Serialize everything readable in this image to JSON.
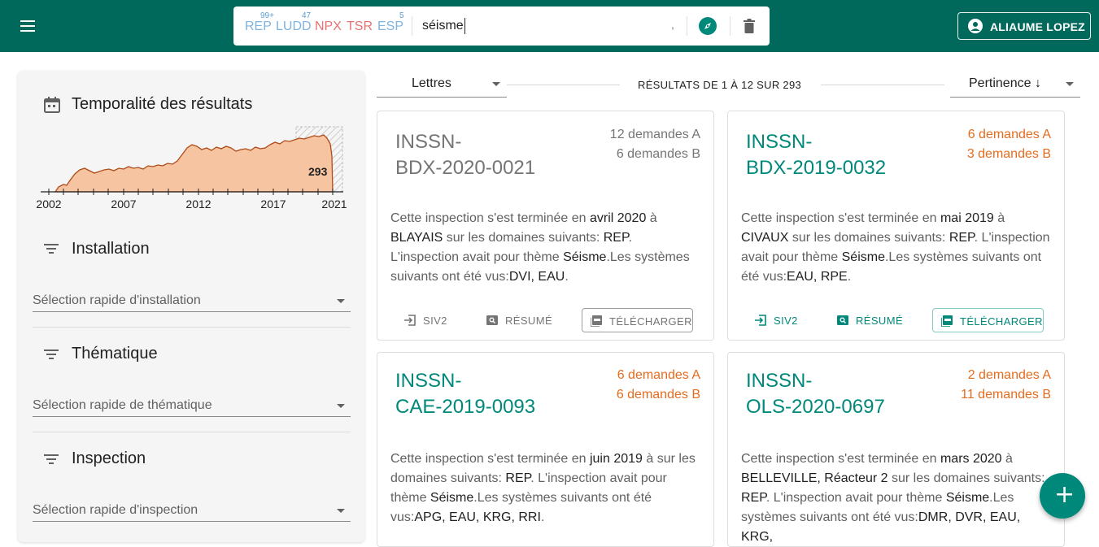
{
  "header": {
    "user_name": "ALIAUME LOPEZ",
    "search_value": "séisme",
    "search_comma": ",",
    "chips": [
      {
        "label": "REP",
        "count": "99+",
        "color": "#7fb3e0"
      },
      {
        "label": "LUDD",
        "count": "47",
        "color": "#7fb3e0"
      },
      {
        "label": "NPX",
        "count": "",
        "color": "#e57373"
      },
      {
        "label": "TSR",
        "count": "",
        "color": "#e57373"
      },
      {
        "label": "ESP",
        "count": "5",
        "color": "#7fb3e0"
      }
    ]
  },
  "sidebar": {
    "temporality_title": "Temporalité des résultats",
    "chart_value_label": "293",
    "chart_ticks": [
      "2002",
      "2007",
      "2012",
      "2017",
      "2021"
    ],
    "installation_title": "Installation",
    "installation_placeholder": "Sélection rapide d'installation",
    "thematique_title": "Thématique",
    "thematique_placeholder": "Sélection rapide de thématique",
    "inspection_title": "Inspection",
    "inspection_placeholder": "Sélection rapide d'inspection"
  },
  "results": {
    "group_select": "Lettres",
    "count_text": "RÉSULTATS DE 1 À 12 SUR 293",
    "sort_select": "Pertinence ↓"
  },
  "cards": [
    {
      "title_line1": "INSSN-",
      "title_line2": "BDX-2020-0021",
      "demands_a": "12 demandes A",
      "demands_b": "6 demandes B",
      "desc": [
        {
          "t": "Cette inspection s'est terminée en ",
          "b": false
        },
        {
          "t": "avril 2020",
          "b": true
        },
        {
          "t": " à ",
          "b": false
        },
        {
          "t": "BLAYAIS",
          "b": true
        },
        {
          "t": " sur les domaines suivants: ",
          "b": false
        },
        {
          "t": "REP",
          "b": true
        },
        {
          "t": ". L'inspection avait pour thème ",
          "b": false
        },
        {
          "t": "Séisme",
          "b": true
        },
        {
          "t": ".Les systèmes suivants ont été vus:",
          "b": false
        },
        {
          "t": "DVI, EAU",
          "b": true
        },
        {
          "t": ".",
          "b": false
        }
      ],
      "btn_siv2": "SIV2",
      "btn_resume": "RÉSUMÉ",
      "btn_download": "TÉLÉCHARGER"
    },
    {
      "title_line1": "INSSN-",
      "title_line2": "BDX-2019-0032",
      "demands_a": "6 demandes A",
      "demands_b": "3 demandes B",
      "desc": [
        {
          "t": "Cette inspection s'est terminée en ",
          "b": false
        },
        {
          "t": "mai 2019",
          "b": true
        },
        {
          "t": " à ",
          "b": false
        },
        {
          "t": "CIVAUX",
          "b": true
        },
        {
          "t": " sur les domaines suivants: ",
          "b": false
        },
        {
          "t": "REP",
          "b": true
        },
        {
          "t": ". L'inspection avait pour thème ",
          "b": false
        },
        {
          "t": "Séisme",
          "b": true
        },
        {
          "t": ".Les systèmes suivants ont été vus:",
          "b": false
        },
        {
          "t": "EAU, RPE",
          "b": true
        },
        {
          "t": ".",
          "b": false
        }
      ],
      "btn_siv2": "SIV2",
      "btn_resume": "RÉSUMÉ",
      "btn_download": "TÉLÉCHARGER"
    },
    {
      "title_line1": "INSSN-",
      "title_line2": "CAE-2019-0093",
      "demands_a": "6 demandes A",
      "demands_b": "6 demandes B",
      "desc": [
        {
          "t": "Cette inspection s'est terminée en ",
          "b": false
        },
        {
          "t": "juin 2019",
          "b": true
        },
        {
          "t": " à sur les domaines suivants: ",
          "b": false
        },
        {
          "t": "REP",
          "b": true
        },
        {
          "t": ". L'inspection avait pour thème ",
          "b": false
        },
        {
          "t": "Séisme",
          "b": true
        },
        {
          "t": ".Les systèmes suivants ont été vus:",
          "b": false
        },
        {
          "t": "APG, EAU, KRG, RRI",
          "b": true
        },
        {
          "t": ".",
          "b": false
        }
      ]
    },
    {
      "title_line1": "INSSN-",
      "title_line2": "OLS-2020-0697",
      "demands_a": "2 demandes A",
      "demands_b": "11 demandes B",
      "desc": [
        {
          "t": "Cette inspection s'est terminée en ",
          "b": false
        },
        {
          "t": "mars 2020",
          "b": true
        },
        {
          "t": " à ",
          "b": false
        },
        {
          "t": "BELLEVILLE, Réacteur 2",
          "b": true
        },
        {
          "t": " sur les domaines suivants: ",
          "b": false
        },
        {
          "t": "REP",
          "b": true
        },
        {
          "t": ". L'inspection avait pour thème ",
          "b": false
        },
        {
          "t": "Séisme",
          "b": true
        },
        {
          "t": ".Les systèmes suivants ont été vus:",
          "b": false
        },
        {
          "t": "DMR, DVR, EAU, KRG,",
          "b": true
        }
      ]
    }
  ],
  "fab_icon": "+",
  "colors": {
    "primary": "#00695c",
    "accent": "#00897b",
    "orange": "#e66b1e",
    "chart_fill": "#f6c4a1",
    "chart_stroke": "#b04a17"
  }
}
